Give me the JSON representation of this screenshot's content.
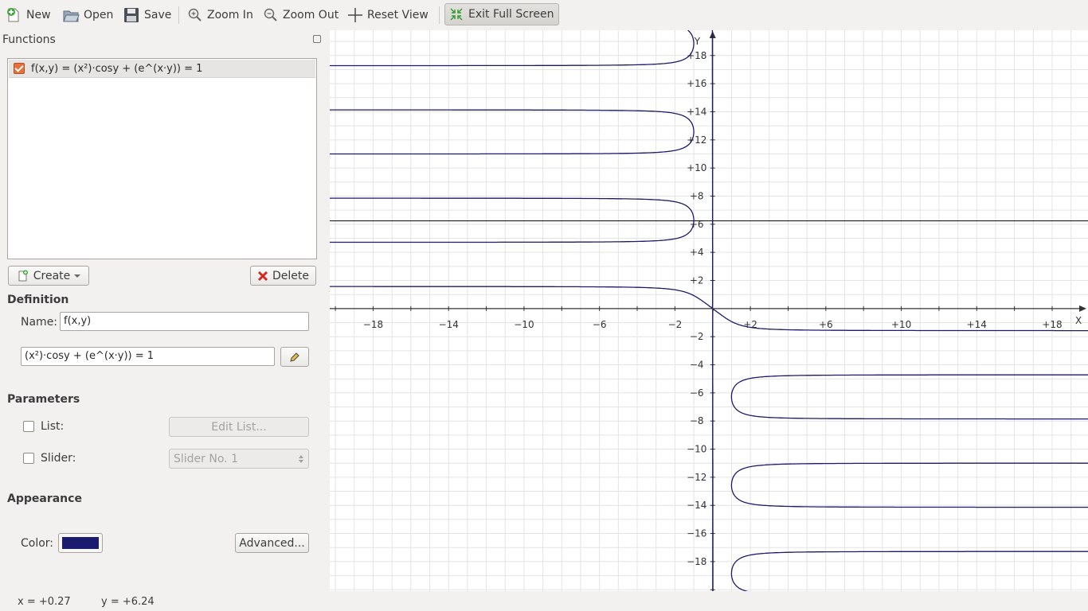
{
  "toolbar": {
    "new_label": "New",
    "open_label": "Open",
    "save_label": "Save",
    "zoom_in_label": "Zoom In",
    "zoom_out_label": "Zoom Out",
    "reset_view_label": "Reset View",
    "exit_full_screen_label": "Exit Full Screen"
  },
  "functions_panel": {
    "title": "Functions",
    "items": [
      {
        "label": "f(x,y) = (x²)·cosy + (e^(x·y)) = 1",
        "checked": true
      }
    ],
    "create_label": "Create",
    "delete_label": "Delete"
  },
  "definition": {
    "title": "Definition",
    "name_label": "Name:",
    "name_value": "f(x,y)",
    "expression_value": "(x²)·cosy + (e^(x·y)) = 1"
  },
  "parameters": {
    "title": "Parameters",
    "list_label": "List:",
    "list_checked": false,
    "edit_list_label": "Edit List...",
    "slider_label": "Slider:",
    "slider_checked": false,
    "slider_value": "Slider No. 1"
  },
  "appearance": {
    "title": "Appearance",
    "color_label": "Color:",
    "color_value": "#1a1a6e",
    "advanced_label": "Advanced..."
  },
  "graph": {
    "x_axis_label": "X",
    "y_axis_label": "Y",
    "x_ticks": [
      "−18",
      "−14",
      "−10",
      "−6",
      "−2",
      "+2",
      "+6",
      "+10",
      "+14",
      "+18"
    ],
    "y_ticks": [
      "+18",
      "+16",
      "+14",
      "+12",
      "+10",
      "+8",
      "+6",
      "+4",
      "+2",
      "−2",
      "−4",
      "−6",
      "−8",
      "−10",
      "−12",
      "−14",
      "−16",
      "−18"
    ],
    "x_range": [
      -20.3,
      19.9
    ],
    "y_range": [
      -20.1,
      19.8
    ],
    "grid": true,
    "crosshair": {
      "x": 0.27,
      "y": 6.24
    },
    "curve_color": "#1a1a6e"
  },
  "status": {
    "x_text": "x = +0.27",
    "y_text": "y = +6.24"
  }
}
